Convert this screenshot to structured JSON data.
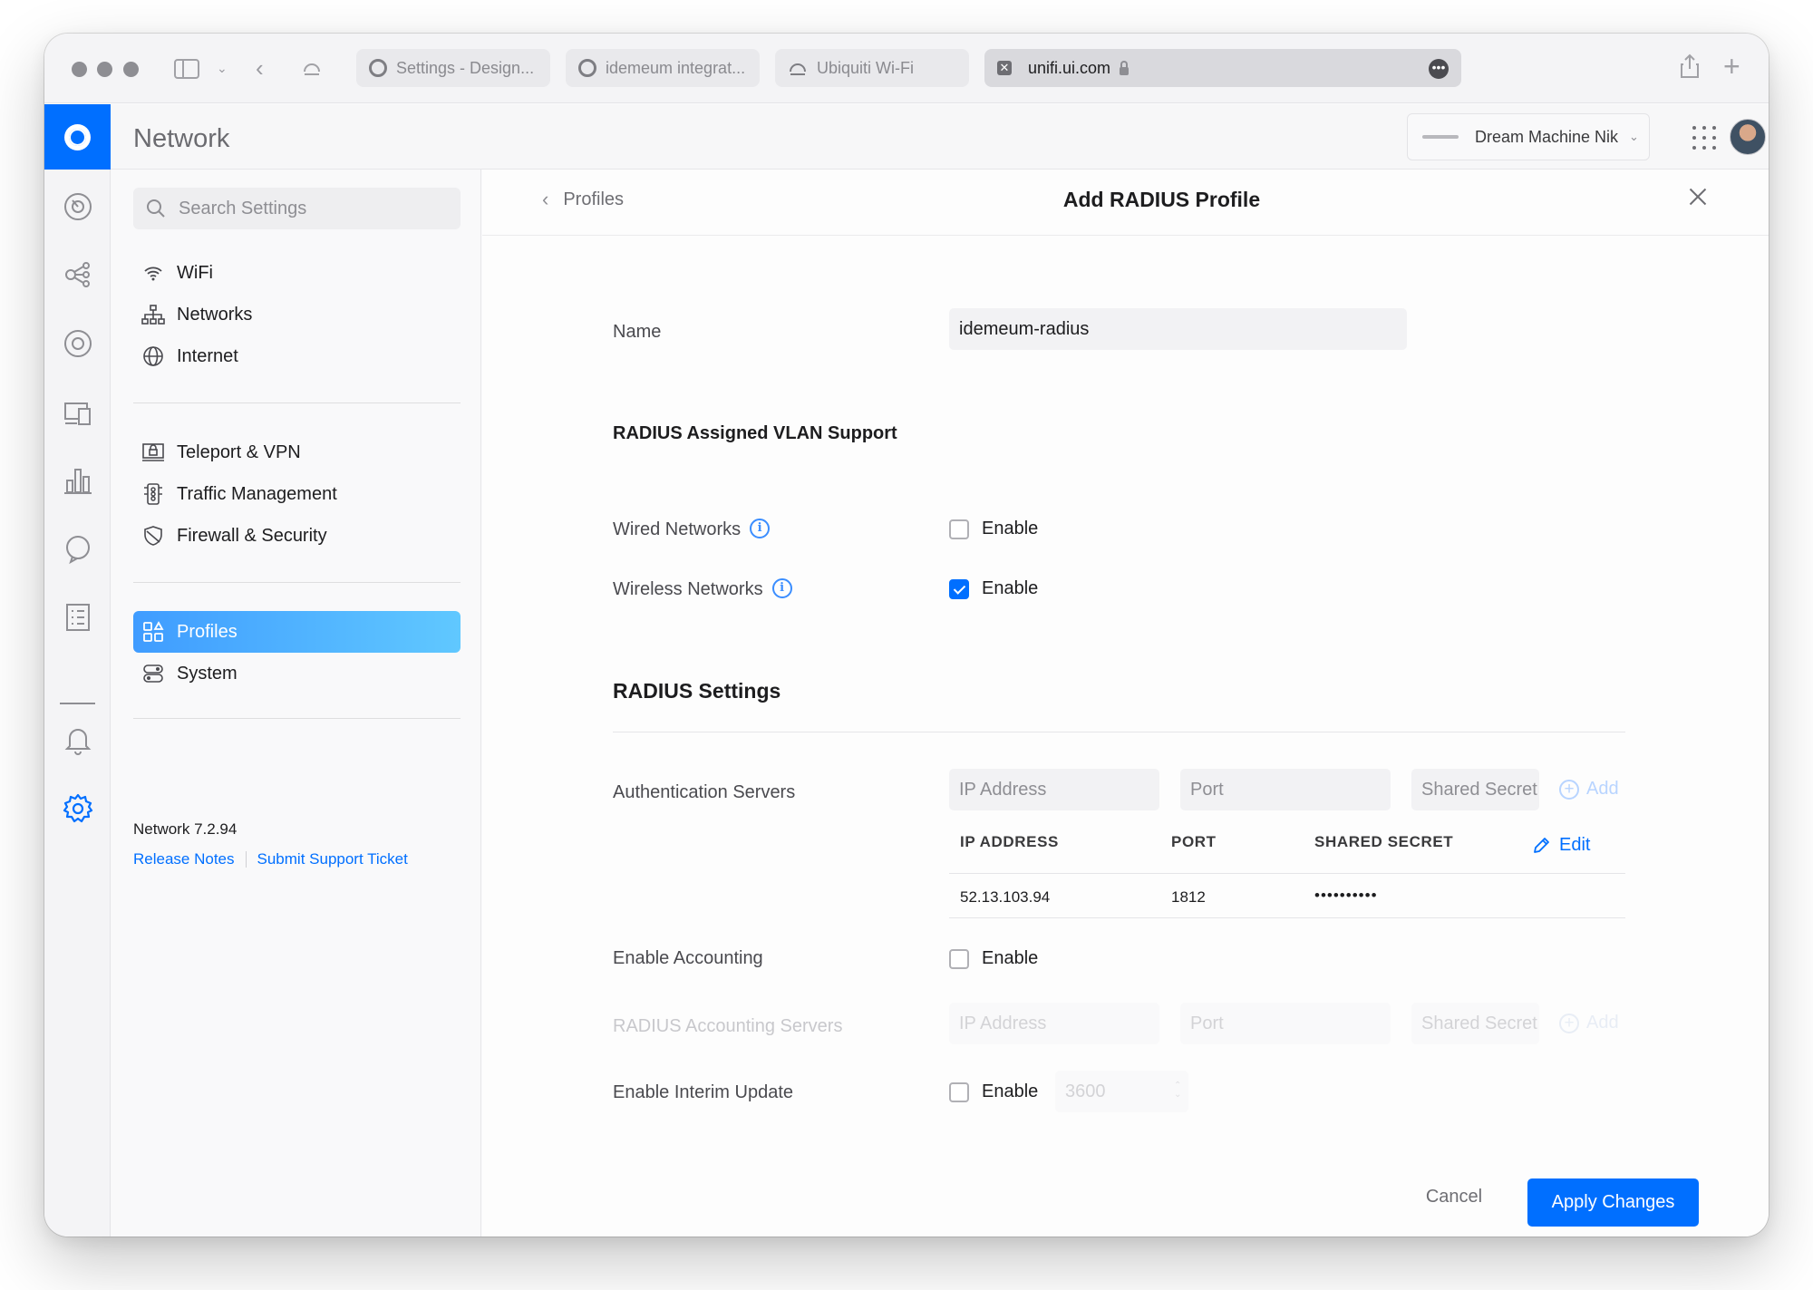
{
  "browser": {
    "tabs": [
      {
        "label": "Settings - Design..."
      },
      {
        "label": "idemeum integrat..."
      },
      {
        "label": "Ubiquiti Wi-Fi"
      }
    ],
    "address": "unifi.ui.com",
    "address_favicon": "✕"
  },
  "app": {
    "name": "Network",
    "device": "Dream Machine Nik",
    "brand_color": "#006fff"
  },
  "rail": {
    "icons": [
      "dashboard-icon",
      "topology-icon",
      "unifi-devices-icon",
      "client-devices-icon",
      "statistics-icon",
      "insights-icon",
      "system-log-icon",
      "notifications-icon",
      "settings-icon"
    ]
  },
  "nav": {
    "search_placeholder": "Search Settings",
    "groups": [
      [
        {
          "label": "WiFi",
          "icon": "wifi-icon"
        },
        {
          "label": "Networks",
          "icon": "networks-icon"
        },
        {
          "label": "Internet",
          "icon": "globe-icon"
        }
      ],
      [
        {
          "label": "Teleport & VPN",
          "icon": "vpn-icon"
        },
        {
          "label": "Traffic Management",
          "icon": "traffic-icon"
        },
        {
          "label": "Firewall & Security",
          "icon": "shield-icon"
        }
      ],
      [
        {
          "label": "Profiles",
          "icon": "profiles-icon",
          "active": true
        },
        {
          "label": "System",
          "icon": "system-icon"
        }
      ]
    ],
    "version": "Network 7.2.94",
    "release_notes": "Release Notes",
    "support": "Submit Support Ticket"
  },
  "panel": {
    "back_label": "Profiles",
    "title": "Add RADIUS Profile",
    "name_label": "Name",
    "name_value": "idemeum-radius",
    "vlan_section": "RADIUS Assigned VLAN Support",
    "wired_label": "Wired Networks",
    "wired_enable": "Enable",
    "wired_checked": false,
    "wireless_label": "Wireless Networks",
    "wireless_enable": "Enable",
    "wireless_checked": true,
    "radius_section": "RADIUS Settings",
    "auth_label": "Authentication Servers",
    "ip_placeholder": "IP Address",
    "port_placeholder": "Port",
    "secret_placeholder": "Shared Secret",
    "add_label": "Add",
    "table": {
      "headers": [
        "IP ADDRESS",
        "PORT",
        "SHARED SECRET"
      ],
      "edit_label": "Edit",
      "rows": [
        {
          "ip": "52.13.103.94",
          "port": "1812",
          "secret": "••••••••••"
        }
      ]
    },
    "accounting_label": "Enable Accounting",
    "accounting_enable": "Enable",
    "acct_servers_label": "RADIUS Accounting Servers",
    "interim_label": "Enable Interim Update",
    "interim_enable": "Enable",
    "interim_value": "3600",
    "cancel_label": "Cancel",
    "apply_label": "Apply Changes"
  }
}
